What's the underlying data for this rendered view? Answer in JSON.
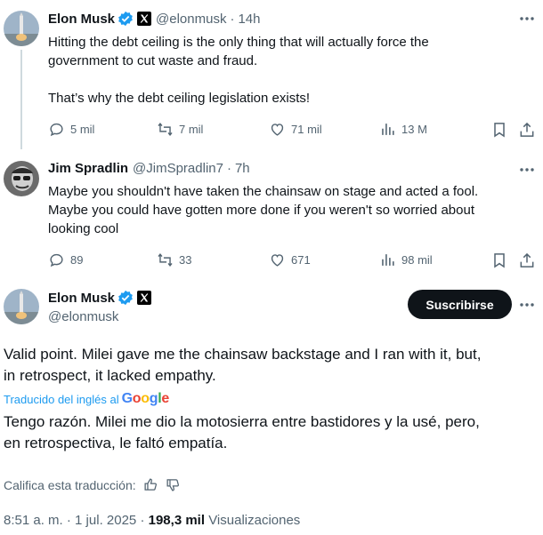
{
  "tweet1": {
    "name": "Elon Musk",
    "handle": "@elonmusk",
    "dot": "·",
    "time": "14h",
    "text_line1": "Hitting the debt ceiling is the only thing that will actually force the",
    "text_line2": "government to cut waste and fraud.",
    "text_line3": "That’s why the debt ceiling legislation exists!",
    "replies": "5 mil",
    "reposts": "7 mil",
    "likes": "71 mil",
    "views": "13 M"
  },
  "tweet2": {
    "name": "Jim Spradlin",
    "handle": "@JimSpradlin7",
    "dot": "·",
    "time": "7h",
    "text_line1": "Maybe you shouldn't have taken the chainsaw on stage and acted a fool.",
    "text_line2": "Maybe you could have gotten more done if you weren't so worried about",
    "text_line3": "looking cool",
    "replies": "89",
    "reposts": "33",
    "likes": "671",
    "views": "98 mil"
  },
  "main": {
    "name": "Elon Musk",
    "handle": "@elonmusk",
    "follow_label": "Suscribirse",
    "text_line1": "Valid point. Milei gave me the chainsaw backstage and I ran with it, but,",
    "text_line2": "in retrospect, it lacked empathy.",
    "translated_by": "Traducido del inglés al",
    "google": "Google",
    "translation_line1": "Tengo razón. Milei me dio la motosierra entre bastidores y la usé, pero,",
    "translation_line2": "en retrospectiva, le faltó empatía.",
    "rate_label": "Califica esta traducción:",
    "time": "8:51 a. m.",
    "sep": "·",
    "date": "1 jul. 2025",
    "views_count": "198,3 mil",
    "views_label": "Visualizaciones"
  },
  "colors": {
    "verified": "#1d9bf0",
    "text": "#0f1419",
    "secondary": "#536471",
    "link": "#1d9bf0"
  }
}
